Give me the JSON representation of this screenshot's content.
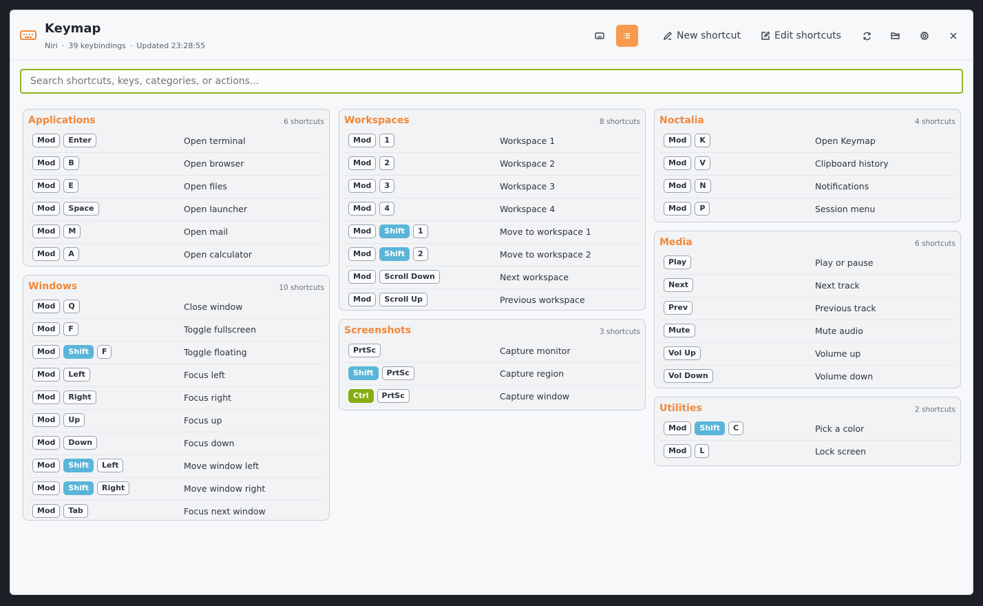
{
  "header": {
    "title": "Keymap",
    "compositor": "Niri",
    "sep": "·",
    "binding_count": "39 keybindings",
    "updated": "Updated 23:28:55",
    "new_label": "New shortcut",
    "edit_label": "Edit shortcuts"
  },
  "search": {
    "placeholder": "Search shortcuts, keys, categories, or actions..."
  },
  "colors": {
    "accent": "#f0883b",
    "shift": "#5ab5d8",
    "ctrl": "#83ad12",
    "search_border": "#8fb51e"
  },
  "categories": [
    {
      "title": "Applications",
      "count": "6 shortcuts",
      "items": [
        {
          "keys": [
            [
              "Mod"
            ],
            [
              "Enter"
            ]
          ],
          "action": "Open terminal"
        },
        {
          "keys": [
            [
              "Mod"
            ],
            [
              "B"
            ]
          ],
          "action": "Open browser"
        },
        {
          "keys": [
            [
              "Mod"
            ],
            [
              "E"
            ]
          ],
          "action": "Open files"
        },
        {
          "keys": [
            [
              "Mod"
            ],
            [
              "Space"
            ]
          ],
          "action": "Open launcher"
        },
        {
          "keys": [
            [
              "Mod"
            ],
            [
              "M"
            ]
          ],
          "action": "Open mail"
        },
        {
          "keys": [
            [
              "Mod"
            ],
            [
              "A"
            ]
          ],
          "action": "Open calculator"
        }
      ]
    },
    {
      "title": "Windows",
      "count": "10 shortcuts",
      "items": [
        {
          "keys": [
            [
              "Mod"
            ],
            [
              "Q"
            ]
          ],
          "action": "Close window"
        },
        {
          "keys": [
            [
              "Mod"
            ],
            [
              "F"
            ]
          ],
          "action": "Toggle fullscreen"
        },
        {
          "keys": [
            [
              "Mod"
            ],
            [
              "Shift",
              "shift"
            ],
            [
              "F"
            ]
          ],
          "action": "Toggle floating"
        },
        {
          "keys": [
            [
              "Mod"
            ],
            [
              "Left"
            ]
          ],
          "action": "Focus left"
        },
        {
          "keys": [
            [
              "Mod"
            ],
            [
              "Right"
            ]
          ],
          "action": "Focus right"
        },
        {
          "keys": [
            [
              "Mod"
            ],
            [
              "Up"
            ]
          ],
          "action": "Focus up"
        },
        {
          "keys": [
            [
              "Mod"
            ],
            [
              "Down"
            ]
          ],
          "action": "Focus down"
        },
        {
          "keys": [
            [
              "Mod"
            ],
            [
              "Shift",
              "shift"
            ],
            [
              "Left"
            ]
          ],
          "action": "Move window left"
        },
        {
          "keys": [
            [
              "Mod"
            ],
            [
              "Shift",
              "shift"
            ],
            [
              "Right"
            ]
          ],
          "action": "Move window right"
        },
        {
          "keys": [
            [
              "Mod"
            ],
            [
              "Tab"
            ]
          ],
          "action": "Focus next window"
        }
      ]
    },
    {
      "title": "Workspaces",
      "count": "8 shortcuts",
      "items": [
        {
          "keys": [
            [
              "Mod"
            ],
            [
              "1"
            ]
          ],
          "action": "Workspace 1"
        },
        {
          "keys": [
            [
              "Mod"
            ],
            [
              "2"
            ]
          ],
          "action": "Workspace 2"
        },
        {
          "keys": [
            [
              "Mod"
            ],
            [
              "3"
            ]
          ],
          "action": "Workspace 3"
        },
        {
          "keys": [
            [
              "Mod"
            ],
            [
              "4"
            ]
          ],
          "action": "Workspace 4"
        },
        {
          "keys": [
            [
              "Mod"
            ],
            [
              "Shift",
              "shift"
            ],
            [
              "1"
            ]
          ],
          "action": "Move to workspace 1"
        },
        {
          "keys": [
            [
              "Mod"
            ],
            [
              "Shift",
              "shift"
            ],
            [
              "2"
            ]
          ],
          "action": "Move to workspace 2"
        },
        {
          "keys": [
            [
              "Mod"
            ],
            [
              "Scroll Down"
            ]
          ],
          "action": "Next workspace"
        },
        {
          "keys": [
            [
              "Mod"
            ],
            [
              "Scroll Up"
            ]
          ],
          "action": "Previous workspace"
        }
      ]
    },
    {
      "title": "Screenshots",
      "count": "3 shortcuts",
      "items": [
        {
          "keys": [
            [
              "PrtSc"
            ]
          ],
          "action": "Capture monitor"
        },
        {
          "keys": [
            [
              "Shift",
              "shift"
            ],
            [
              "PrtSc"
            ]
          ],
          "action": "Capture region"
        },
        {
          "keys": [
            [
              "Ctrl",
              "ctrl"
            ],
            [
              "PrtSc"
            ]
          ],
          "action": "Capture window"
        }
      ]
    },
    {
      "title": "Noctalia",
      "count": "4 shortcuts",
      "items": [
        {
          "keys": [
            [
              "Mod"
            ],
            [
              "K"
            ]
          ],
          "action": "Open Keymap"
        },
        {
          "keys": [
            [
              "Mod"
            ],
            [
              "V"
            ]
          ],
          "action": "Clipboard history"
        },
        {
          "keys": [
            [
              "Mod"
            ],
            [
              "N"
            ]
          ],
          "action": "Notifications"
        },
        {
          "keys": [
            [
              "Mod"
            ],
            [
              "P"
            ]
          ],
          "action": "Session menu"
        }
      ]
    },
    {
      "title": "Media",
      "count": "6 shortcuts",
      "items": [
        {
          "keys": [
            [
              "Play"
            ]
          ],
          "action": "Play or pause"
        },
        {
          "keys": [
            [
              "Next"
            ]
          ],
          "action": "Next track"
        },
        {
          "keys": [
            [
              "Prev"
            ]
          ],
          "action": "Previous track"
        },
        {
          "keys": [
            [
              "Mute"
            ]
          ],
          "action": "Mute audio"
        },
        {
          "keys": [
            [
              "Vol Up"
            ]
          ],
          "action": "Volume up"
        },
        {
          "keys": [
            [
              "Vol Down"
            ]
          ],
          "action": "Volume down"
        }
      ]
    },
    {
      "title": "Utilities",
      "count": "2 shortcuts",
      "items": [
        {
          "keys": [
            [
              "Mod"
            ],
            [
              "Shift",
              "shift"
            ],
            [
              "C"
            ]
          ],
          "action": "Pick a color"
        },
        {
          "keys": [
            [
              "Mod"
            ],
            [
              "L"
            ]
          ],
          "action": "Lock screen"
        }
      ]
    }
  ]
}
